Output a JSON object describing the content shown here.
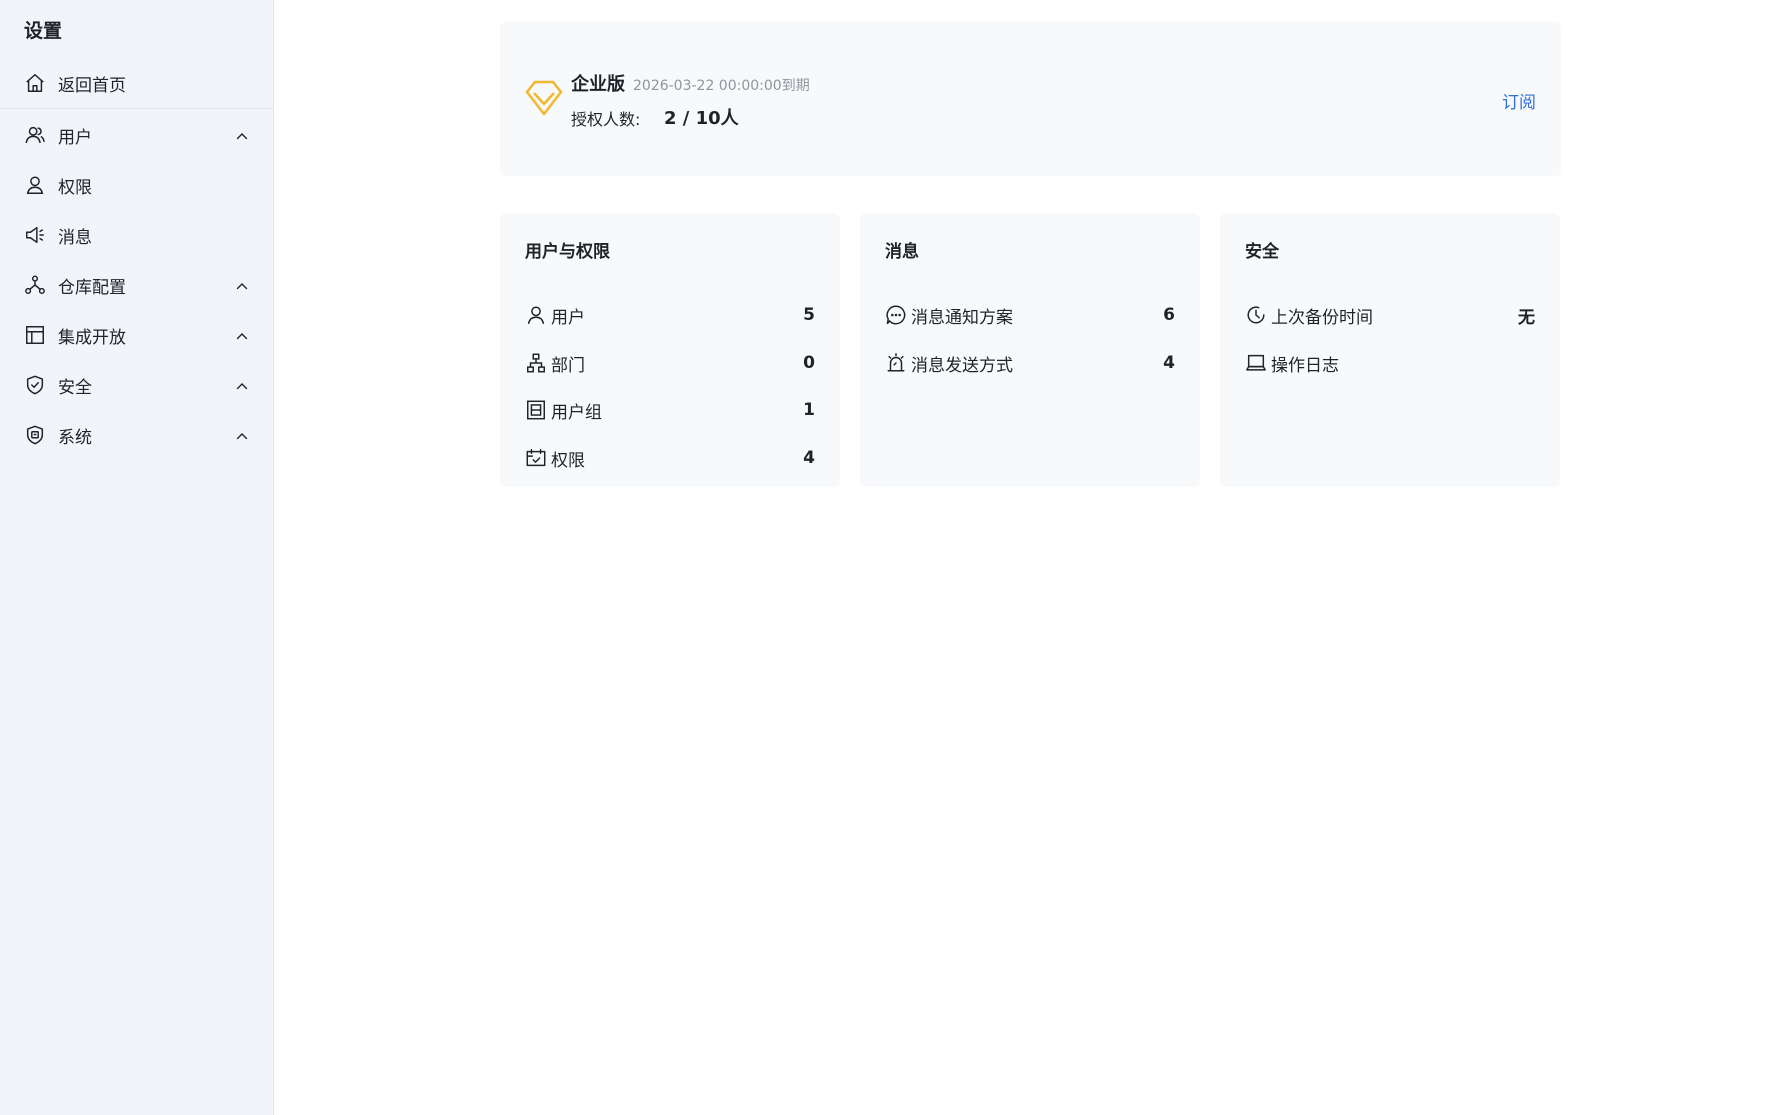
{
  "sidebar": {
    "title": "设置",
    "items": [
      {
        "label": "返回首页",
        "icon": "home-icon"
      },
      {
        "label": "用户",
        "icon": "users-icon",
        "expandable": true
      },
      {
        "label": "权限",
        "icon": "user-icon"
      },
      {
        "label": "消息",
        "icon": "megaphone-icon"
      },
      {
        "label": "仓库配置",
        "icon": "network-icon",
        "expandable": true
      },
      {
        "label": "集成开放",
        "icon": "layout-icon",
        "expandable": true
      },
      {
        "label": "安全",
        "icon": "shield-check-icon",
        "expandable": true
      },
      {
        "label": "系统",
        "icon": "shield-system-icon",
        "expandable": true
      }
    ]
  },
  "license": {
    "edition": "企业版",
    "expire": "2026-03-22 00:00:00到期",
    "seats_label": "授权人数:",
    "seats_value": "2 / 10人",
    "subscribe_label": "订阅",
    "icon": "diamond-icon",
    "icon_color": "#f2b733"
  },
  "cards": [
    {
      "title": "用户与权限",
      "rows": [
        {
          "label": "用户",
          "value": "5",
          "icon": "user-icon"
        },
        {
          "label": "部门",
          "value": "0",
          "icon": "org-chart-icon"
        },
        {
          "label": "用户组",
          "value": "1",
          "icon": "group-icon"
        },
        {
          "label": "权限",
          "value": "4",
          "icon": "permission-icon"
        }
      ]
    },
    {
      "title": "消息",
      "rows": [
        {
          "label": "消息通知方案",
          "value": "6",
          "icon": "chat-bubble-icon"
        },
        {
          "label": "消息发送方式",
          "value": "4",
          "icon": "alarm-icon"
        }
      ]
    },
    {
      "title": "安全",
      "rows": [
        {
          "label": "上次备份时间",
          "value": "无",
          "icon": "clock-icon"
        },
        {
          "label": "操作日志",
          "value": "",
          "icon": "laptop-icon"
        }
      ]
    }
  ],
  "colors": {
    "sidebar_bg": "#f1f4fb",
    "card_bg": "#f8f9fb",
    "link": "#2f6fd6",
    "accent": "#f2b733"
  }
}
